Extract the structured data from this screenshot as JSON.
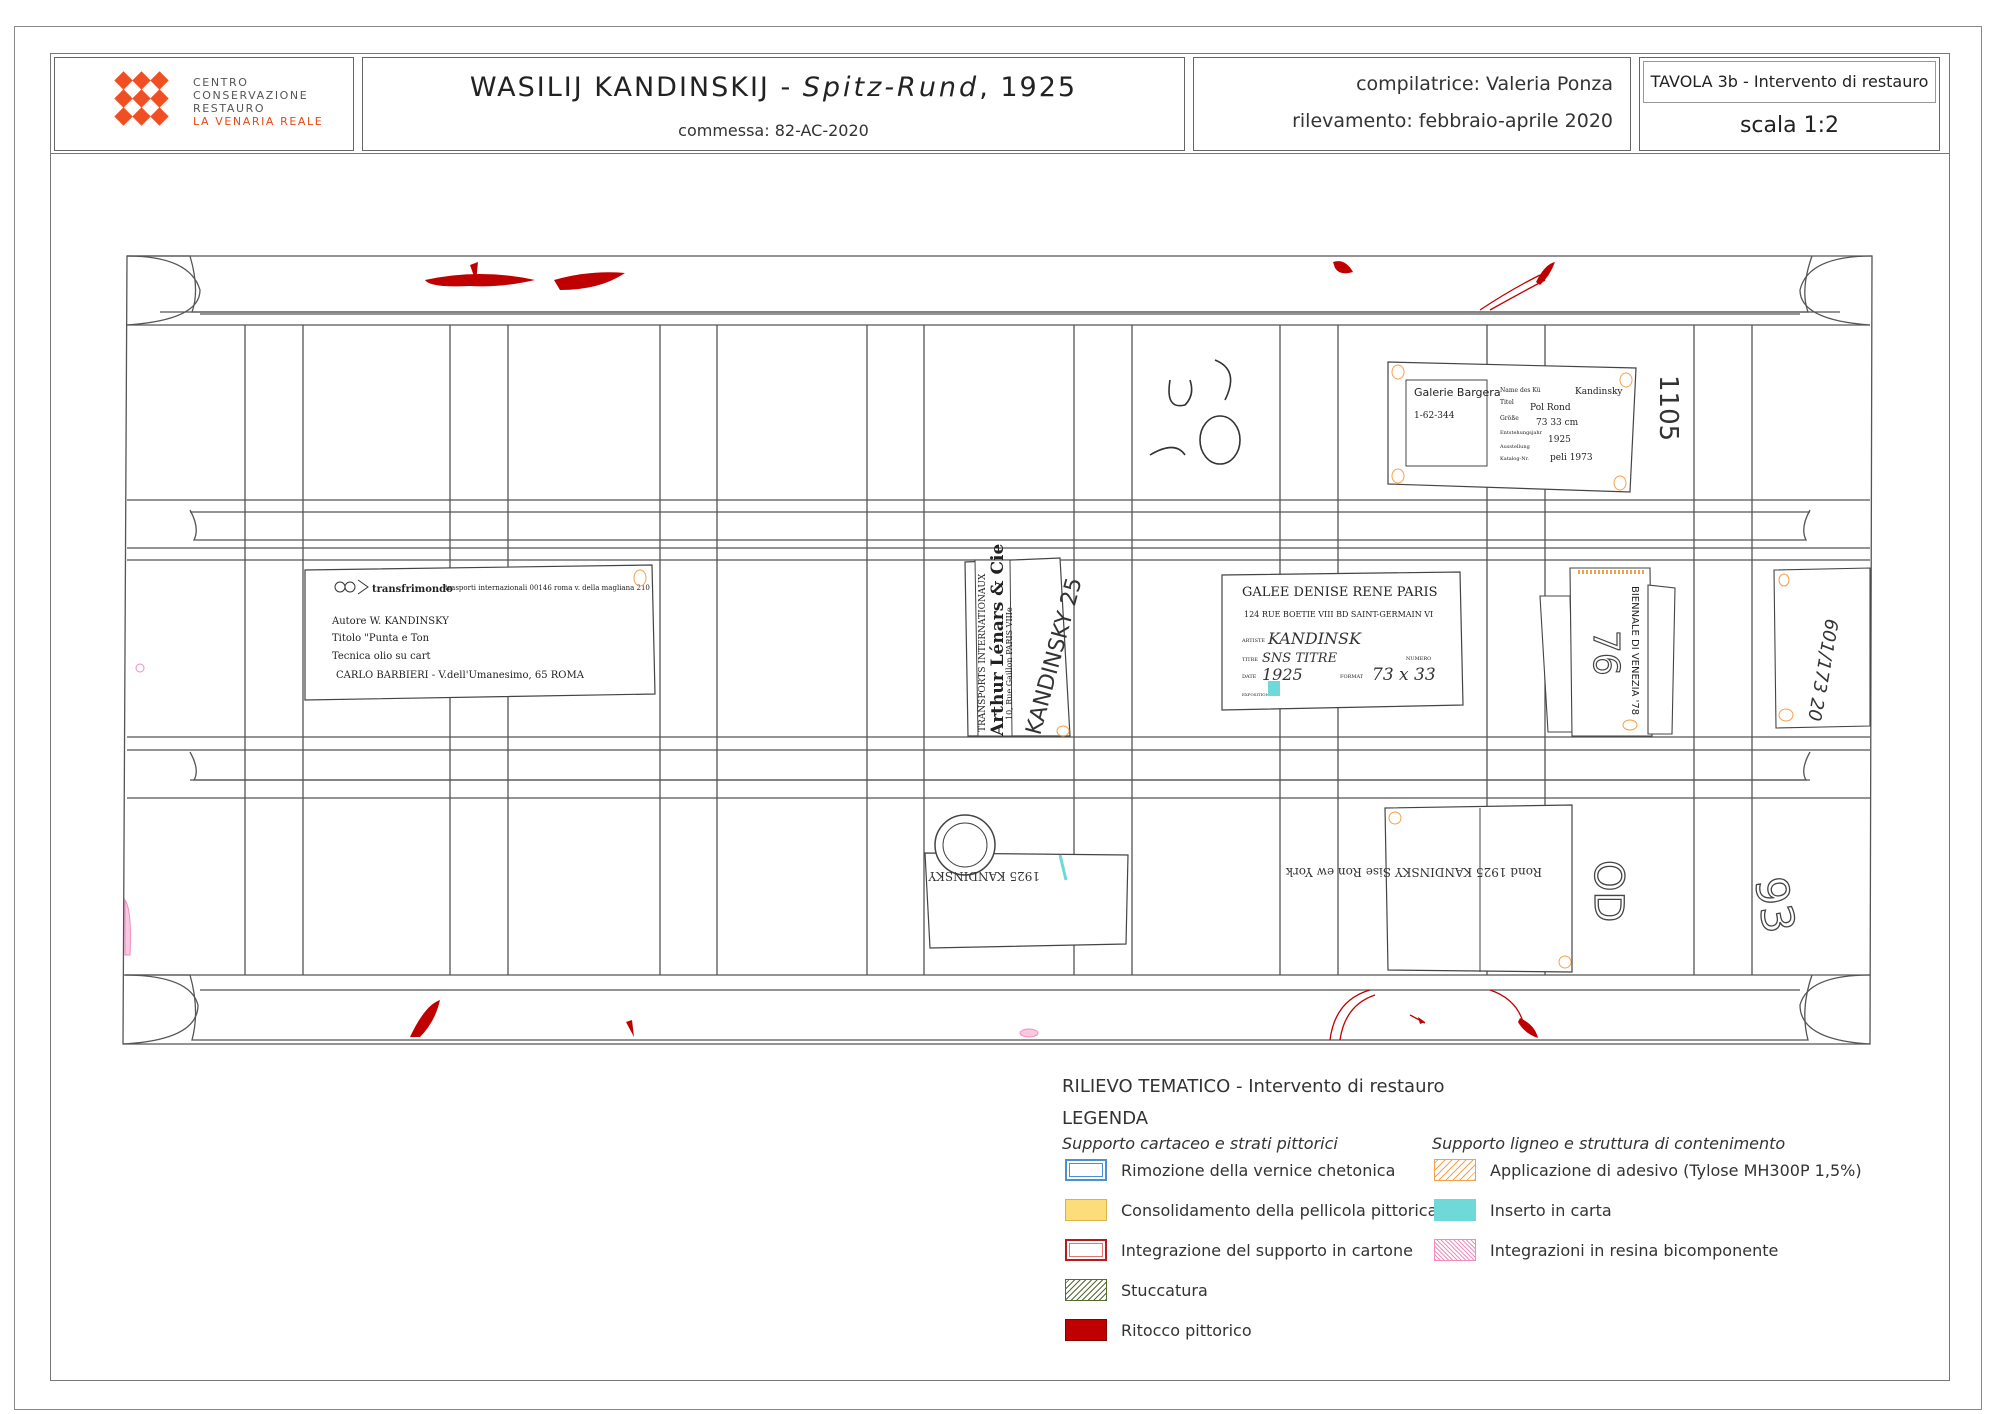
{
  "header": {
    "logo": {
      "line1": "CENTRO",
      "line2": "CONSERVAZIONE",
      "line3": "RESTAURO",
      "line4": "LA VENARIA REALE"
    },
    "title_prefix": "WASILIJ KANDINSKIJ - ",
    "title_italic": "Spitz-Rund",
    "title_suffix": ", 1925",
    "commessa": "commessa: 82-AC-2020",
    "compilatrice": "compilatrice: Valeria Ponza",
    "rilevamento": "rilevamento: febbraio-aprile 2020",
    "tavola": "TAVOLA 3b - Intervento di restauro",
    "scala": "scala 1:2"
  },
  "labels": {
    "label1": {
      "brand": "transfrimondo",
      "addr": "trasporti internazionali 00146 roma v. della magliana 210",
      "autore": "Autore W. KANDINSKY",
      "titolo": "Titolo \"Punta e Ton",
      "tecnica": "Tecnica olio su cart",
      "owner": "CARLO BARBIERI - V.dell'Umanesimo, 65 ROMA"
    },
    "label2": {
      "line1": "TRANSPORTS INTERNATIONAUX",
      "line2": "Arthur Lénars & Cie",
      "line3": "10, Rue Gaillon PARIS VIIIe",
      "hand": "KANDINSKY 25"
    },
    "label3": {
      "gallery": "GALEE DENISE RENE PARIS",
      "addr": "124 RUE BOETIE VIII  BD SAINT-GERMAIN VI",
      "artist_k": "ARTISTE",
      "artist_v": "KANDINSK",
      "title_k": "TITRE",
      "title_v": "SNS TITRE",
      "date_k": "DATE",
      "date_v": "1925",
      "expo_k": "EXPOSITION",
      "format_k": "FORMAT",
      "format_v": "73 x 33",
      "numero_k": "NUMERO"
    },
    "label4": {
      "text": "BIENNALE DI VENEZIA '78",
      "number": "76"
    },
    "label5": {
      "text": "601/173 20"
    },
    "label6": {
      "gal": "Galerie Bargera",
      "num": "1-62-344",
      "k1": "Name des Kü",
      "v1": "Kandinsky",
      "k2": "Titel",
      "v2": "Pol Rond",
      "k3": "Größe",
      "v3": "73 33 cm",
      "k4": "Entstehungsjahr",
      "v4": "1925",
      "k5": "Ausstellung",
      "k6": "Katalog-Nr.",
      "v6": "peli 1973"
    },
    "label7": {
      "text": "1925 KANDINSKY"
    },
    "label8": {
      "text": "Rond 1925 KANDINSKY Sise Ron ew York"
    },
    "hand_top": "1105",
    "hand_95": "95",
    "hand_right": "93",
    "hand_od": "OD"
  },
  "legend": {
    "heading": "RILIEVO TEMATICO - Intervento di restauro",
    "legenda": "LEGENDA",
    "left_title": "Supporto cartaceo e strati pittorici",
    "right_title": "Supporto ligneo e struttura di contenimento",
    "left_items": [
      {
        "label": "Rimozione della vernice chetonica",
        "color": "#4a90d9"
      },
      {
        "label": "Consolidamento della pellicola pittorica",
        "color": "#fddc7a"
      },
      {
        "label": "Integrazione del supporto in cartone",
        "color": "#b71c1c"
      },
      {
        "label": "Stuccatura",
        "color": "#556b2f"
      },
      {
        "label": "Ritocco pittorico",
        "color": "#c00000"
      }
    ],
    "right_items": [
      {
        "label": "Applicazione di adesivo (Tylose MH300P 1,5%)",
        "color": "#f5a04a"
      },
      {
        "label": "Inserto in carta",
        "color": "#6fd8d8"
      },
      {
        "label": "Integrazioni in resina bicomponente",
        "color": "#f08cc0"
      }
    ]
  }
}
